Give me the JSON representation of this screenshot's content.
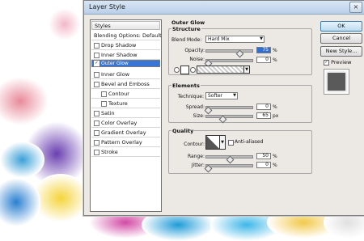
{
  "dialog": {
    "title": "Layer Style"
  },
  "styles_panel": {
    "header": "Styles",
    "items": [
      {
        "label": "Blending Options: Default",
        "checkbox": false,
        "checked": false,
        "selected": false,
        "indent": false
      },
      {
        "label": "Drop Shadow",
        "checkbox": true,
        "checked": false,
        "selected": false,
        "indent": false
      },
      {
        "label": "Inner Shadow",
        "checkbox": true,
        "checked": false,
        "selected": false,
        "indent": false
      },
      {
        "label": "Outer Glow",
        "checkbox": true,
        "checked": true,
        "selected": true,
        "indent": false
      },
      {
        "label": "Inner Glow",
        "checkbox": true,
        "checked": false,
        "selected": false,
        "indent": false
      },
      {
        "label": "Bevel and Emboss",
        "checkbox": true,
        "checked": false,
        "selected": false,
        "indent": false
      },
      {
        "label": "Contour",
        "checkbox": true,
        "checked": false,
        "selected": false,
        "indent": true
      },
      {
        "label": "Texture",
        "checkbox": true,
        "checked": false,
        "selected": false,
        "indent": true
      },
      {
        "label": "Satin",
        "checkbox": true,
        "checked": false,
        "selected": false,
        "indent": false
      },
      {
        "label": "Color Overlay",
        "checkbox": true,
        "checked": false,
        "selected": false,
        "indent": false
      },
      {
        "label": "Gradient Overlay",
        "checkbox": true,
        "checked": false,
        "selected": false,
        "indent": false
      },
      {
        "label": "Pattern Overlay",
        "checkbox": true,
        "checked": false,
        "selected": false,
        "indent": false
      },
      {
        "label": "Stroke",
        "checkbox": true,
        "checked": false,
        "selected": false,
        "indent": false
      }
    ]
  },
  "buttons": {
    "ok": "OK",
    "cancel": "Cancel",
    "new_style": "New Style...",
    "preview": "Preview",
    "preview_checked": true
  },
  "outer_glow": {
    "title": "Outer Glow",
    "structure": {
      "title": "Structure",
      "blend_mode_label": "Blend Mode:",
      "blend_mode": "Hard Mix",
      "opacity_label": "Opacity:",
      "opacity": "75",
      "noise_label": "Noise:",
      "noise": "0",
      "percent": "%"
    },
    "elements": {
      "title": "Elements",
      "technique_label": "Technique:",
      "technique": "Softer",
      "spread_label": "Spread:",
      "spread": "0",
      "size_label": "Size:",
      "size": "65",
      "percent": "%",
      "px": "px"
    },
    "quality": {
      "title": "Quality",
      "contour_label": "Contour:",
      "anti_aliased": "Anti-aliased",
      "range_label": "Range:",
      "range": "50",
      "jitter_label": "Jitter:",
      "jitter": "0",
      "percent": "%"
    }
  },
  "colors": {
    "selection": "#3875d7",
    "dialog_bg": "#ece9e4",
    "ok_accent": "#bcdcf3"
  }
}
